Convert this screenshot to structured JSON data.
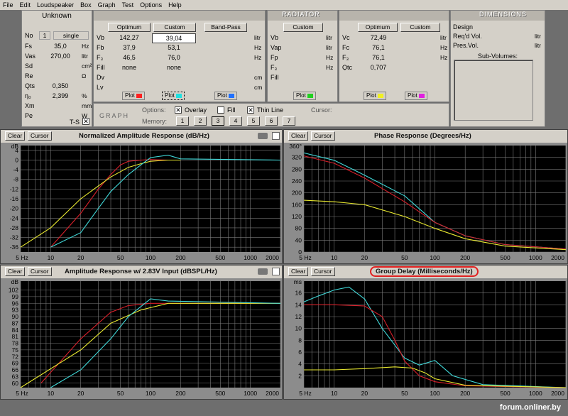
{
  "menu": [
    "File",
    "Edit",
    "Loudspeaker",
    "Box",
    "Graph",
    "Test",
    "Options",
    "Help"
  ],
  "speaker": {
    "name": "Unknown",
    "no_label": "No",
    "no_value": "1",
    "no_mode": "single",
    "params": [
      {
        "label": "Fs",
        "value": "35,0",
        "unit": "Hz"
      },
      {
        "label": "Vas",
        "value": "270,00",
        "unit": "litr"
      },
      {
        "label": "Sd",
        "value": "",
        "unit": "cm²"
      },
      {
        "label": "Re",
        "value": "",
        "unit": "Ω"
      },
      {
        "label": "Qts",
        "value": "0,350",
        "unit": ""
      },
      {
        "label": "η₀",
        "value": "2,399",
        "unit": "%"
      },
      {
        "label": "Xm",
        "value": "",
        "unit": "mm"
      },
      {
        "label": "Pe",
        "value": "",
        "unit": "W"
      }
    ],
    "ts_label": "T-S"
  },
  "vented": {
    "optimum_label": "Optimum",
    "custom_label": "Custom",
    "bandpass_label": "Band-Pass",
    "rows": [
      {
        "label": "Vb",
        "opt": "142,27",
        "cust": "39,04",
        "unit": "litr"
      },
      {
        "label": "Fb",
        "opt": "37,9",
        "cust": "53,1",
        "unit": "Hz"
      },
      {
        "label": "F₃",
        "opt": "46,5",
        "cust": "76,0",
        "unit": "Hz"
      },
      {
        "label": "Fill",
        "opt": "none",
        "cust": "none",
        "unit": ""
      },
      {
        "label": "Dv",
        "opt": "",
        "cust": "",
        "unit": "cm"
      },
      {
        "label": "Lv",
        "opt": "",
        "cust": "",
        "unit": "cm"
      }
    ],
    "plot": "Plot"
  },
  "radiator": {
    "header": "RADIATOR",
    "custom_label": "Custom",
    "rows": [
      {
        "label": "Vb",
        "unit": "litr"
      },
      {
        "label": "Vap",
        "unit": "litr"
      },
      {
        "label": "Fp",
        "unit": "Hz"
      },
      {
        "label": "F₃",
        "unit": "Hz"
      },
      {
        "label": "Fill",
        "unit": ""
      }
    ]
  },
  "closed": {
    "optimum_label": "Optimum",
    "custom_label": "Custom",
    "rows": [
      {
        "label": "Vc",
        "value": "72,49",
        "unit": "litr"
      },
      {
        "label": "Fc",
        "value": "76,1",
        "unit": "Hz"
      },
      {
        "label": "F₃",
        "value": "76,1",
        "unit": "Hz"
      },
      {
        "label": "Qtc",
        "value": "0,707",
        "unit": ""
      }
    ]
  },
  "dimensions": {
    "header": "DIMENSIONS",
    "rows": [
      {
        "label": "Design",
        "unit": ""
      },
      {
        "label": "Req'd Vol.",
        "unit": "litr"
      },
      {
        "label": "Pres.Vol.",
        "unit": "litr"
      }
    ],
    "subvolumes": "Sub-Volumes:"
  },
  "graph": {
    "label": "GRAPH",
    "options_label": "Options:",
    "overlay": "Overlay",
    "fill": "Fill",
    "thinline": "Thin Line",
    "cursor_label": "Cursor:",
    "memory_label": "Memory:",
    "memory_slots": [
      "1",
      "2",
      "3",
      "4",
      "5",
      "6",
      "7"
    ]
  },
  "buttons": {
    "clear": "Clear",
    "cursor": "Cursor"
  },
  "colors": {
    "red": "#ff2020",
    "cyan": "#20e0e0",
    "yellow": "#f0f020",
    "blue": "#2070ff",
    "green": "#20d020",
    "magenta": "#e020e0",
    "orange": "#ff9020"
  },
  "charts": [
    {
      "title": "Normalized Amplitude Response (dB/Hz)",
      "yunit": "dB",
      "yticks": [
        "4",
        "0",
        "-4",
        "-8",
        "-12",
        "-16",
        "-20",
        "-24",
        "-28",
        "-32",
        "-36"
      ]
    },
    {
      "title": "Phase Response (Degrees/Hz)",
      "yunit": "360°",
      "yticks": [
        "320",
        "280",
        "240",
        "200",
        "160",
        "120",
        "80",
        "40",
        "0"
      ]
    },
    {
      "title": "Amplitude Response w/ 2.83V Input (dBSPL/Hz)",
      "yunit": "dB",
      "yticks": [
        "102",
        "99",
        "96",
        "93",
        "90",
        "87",
        "84",
        "81",
        "78",
        "75",
        "72",
        "69",
        "66",
        "63",
        "60"
      ]
    },
    {
      "title": "Group Delay (Milliseconds/Hz)",
      "yunit": "ms",
      "yticks": [
        "16",
        "14",
        "12",
        "10",
        "8",
        "6",
        "4",
        "2"
      ]
    }
  ],
  "xticks": [
    "5 Hz",
    "10",
    "20",
    "50",
    "100",
    "200",
    "500",
    "1000",
    "2000"
  ],
  "chart_data": [
    {
      "type": "line",
      "title": "Normalized Amplitude Response (dB/Hz)",
      "ylabel": "dB",
      "xlim": [
        5,
        2000
      ],
      "ylim": [
        -38,
        6
      ],
      "xscale": "log",
      "series": [
        {
          "color": "red",
          "x": [
            10,
            20,
            30,
            40,
            50,
            60,
            80,
            100,
            150
          ],
          "y": [
            -36,
            -22,
            -12,
            -6,
            -2,
            -0.5,
            0,
            0.2,
            0
          ]
        },
        {
          "color": "yellow",
          "x": [
            5,
            10,
            20,
            40,
            60,
            80,
            100,
            150,
            200
          ],
          "y": [
            -36,
            -28,
            -16,
            -7,
            -3,
            -1.5,
            -0.5,
            0,
            0
          ]
        },
        {
          "color": "cyan",
          "x": [
            10,
            20,
            30,
            40,
            60,
            80,
            100,
            150,
            200,
            2000
          ],
          "y": [
            -36,
            -30,
            -20,
            -13,
            -6,
            -2,
            1,
            2,
            0.5,
            0
          ]
        }
      ]
    },
    {
      "type": "line",
      "title": "Phase Response (Degrees/Hz)",
      "ylabel": "°",
      "xlim": [
        5,
        2000
      ],
      "ylim": [
        0,
        360
      ],
      "xscale": "log",
      "series": [
        {
          "color": "cyan",
          "x": [
            5,
            10,
            20,
            50,
            100,
            200,
            500,
            2000
          ],
          "y": [
            335,
            310,
            260,
            190,
            100,
            55,
            25,
            10
          ]
        },
        {
          "color": "red",
          "x": [
            5,
            10,
            20,
            50,
            100,
            200,
            500,
            2000
          ],
          "y": [
            325,
            300,
            250,
            170,
            100,
            55,
            25,
            10
          ]
        },
        {
          "color": "yellow",
          "x": [
            5,
            10,
            20,
            50,
            100,
            200,
            500,
            2000
          ],
          "y": [
            175,
            170,
            160,
            120,
            80,
            45,
            20,
            8
          ]
        }
      ]
    },
    {
      "type": "line",
      "title": "Amplitude Response w/ 2.83V Input (dBSPL/Hz)",
      "ylabel": "dB",
      "xlim": [
        5,
        2000
      ],
      "ylim": [
        58,
        106
      ],
      "xscale": "log",
      "series": [
        {
          "color": "red",
          "x": [
            8,
            20,
            40,
            60,
            100,
            200,
            2000
          ],
          "y": [
            60,
            80,
            92,
            95,
            96,
            96,
            96
          ]
        },
        {
          "color": "yellow",
          "x": [
            5,
            20,
            40,
            80,
            150,
            200,
            2000
          ],
          "y": [
            58,
            75,
            87,
            93,
            96,
            96,
            96
          ]
        },
        {
          "color": "cyan",
          "x": [
            10,
            20,
            40,
            60,
            100,
            150,
            2000
          ],
          "y": [
            58,
            66,
            80,
            90,
            98,
            97,
            96
          ]
        }
      ]
    },
    {
      "type": "line",
      "title": "Group Delay (Milliseconds/Hz)",
      "ylabel": "ms",
      "xlim": [
        5,
        2000
      ],
      "ylim": [
        0,
        18
      ],
      "xscale": "log",
      "series": [
        {
          "color": "cyan",
          "x": [
            5,
            7,
            10,
            14,
            20,
            30,
            50,
            70,
            100,
            150,
            300,
            2000
          ],
          "y": [
            14.5,
            15.5,
            16.5,
            17,
            15,
            10,
            5,
            3.8,
            4.6,
            2,
            0.5,
            0
          ]
        },
        {
          "color": "red",
          "x": [
            5,
            10,
            20,
            30,
            40,
            50,
            70,
            100,
            200,
            2000
          ],
          "y": [
            14,
            14,
            13.8,
            12,
            8,
            4.5,
            2,
            1,
            0.3,
            0
          ]
        },
        {
          "color": "yellow",
          "x": [
            5,
            10,
            20,
            40,
            60,
            80,
            100,
            200,
            2000
          ],
          "y": [
            3,
            3,
            3.2,
            3.5,
            3.3,
            2.5,
            1.5,
            0.4,
            0
          ]
        }
      ]
    }
  ],
  "watermark": "forum.onliner.by"
}
